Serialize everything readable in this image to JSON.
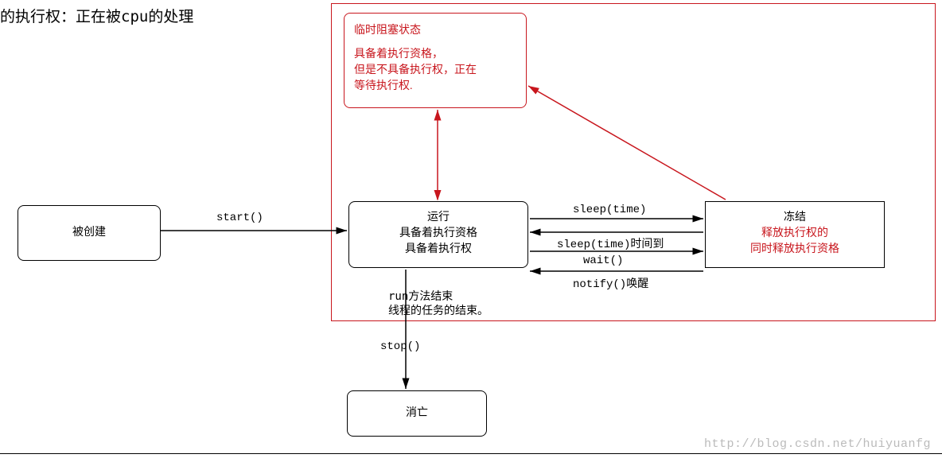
{
  "title_partial": "的执行权：正在被cpu的处理",
  "container": {},
  "temp_block": {
    "title": "临时阻塞状态",
    "line1": "具备着执行资格，",
    "line2": "但是不具备执行权，正在",
    "line3": "等待执行权."
  },
  "created": {
    "title": "被创建"
  },
  "running": {
    "title": "运行",
    "line1": "具备着执行资格",
    "line2": "具备着执行权"
  },
  "frozen": {
    "title": "冻结",
    "line1": "释放执行权的",
    "line2": "同时释放执行资格"
  },
  "dead": {
    "title": "消亡"
  },
  "edges": {
    "start": "start()",
    "run_end_1": "run方法结束",
    "run_end_2": "线程的任务的结束。",
    "stop": "stop()",
    "sleep": "sleep(time)",
    "sleep_done": "sleep(time)时间到",
    "wait": "wait()",
    "notify": "notify()唤醒"
  },
  "watermark": "http://blog.csdn.net/huiyuanfg"
}
